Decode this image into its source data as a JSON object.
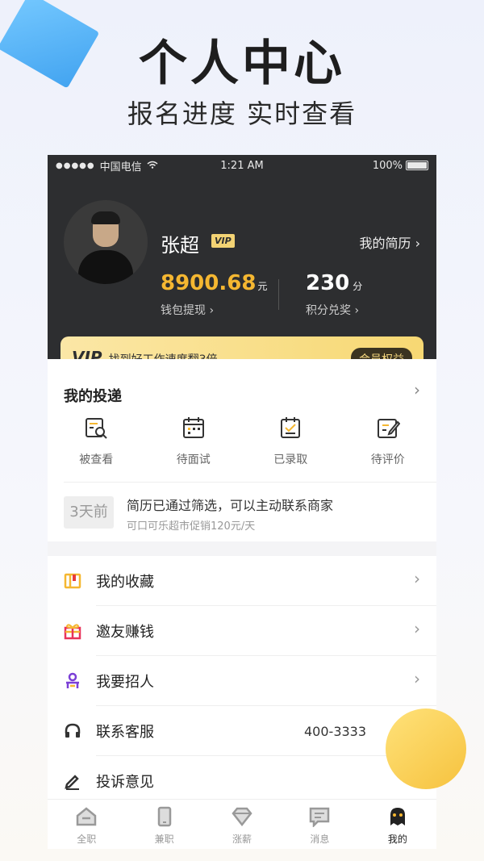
{
  "hero": {
    "title": "个人中心",
    "subtitle": "报名进度  实时查看"
  },
  "status_bar": {
    "signal": "●●●●●",
    "carrier": "中国电信",
    "time": "1:21 AM",
    "battery": "100%"
  },
  "profile": {
    "name": "张超",
    "vip_badge": "VIP",
    "resume_link": "我的简历 ›",
    "wallet_value": "8900.68",
    "wallet_unit": "元",
    "wallet_link": "钱包提现 ›",
    "points_value": "230",
    "points_unit": "分",
    "points_link": "积分兑奖 ›"
  },
  "vip_bar": {
    "label": "VIP",
    "text": "找到好工作速度翻3倍",
    "button": "会员权益"
  },
  "delivery": {
    "title": "我的投递",
    "stats": [
      {
        "label": "被查看",
        "icon": "viewed-icon"
      },
      {
        "label": "待面试",
        "icon": "calendar-icon"
      },
      {
        "label": "已录取",
        "icon": "accepted-icon"
      },
      {
        "label": "待评价",
        "icon": "review-icon"
      }
    ],
    "notice": {
      "days": "3天前",
      "message": "简历已通过筛选，可以主动联系商家",
      "sub": "可口可乐超市促销120元/天"
    }
  },
  "menu": [
    {
      "label": "我的收藏",
      "icon": "favorites-icon",
      "value": ""
    },
    {
      "label": "邀友赚钱",
      "icon": "gift-icon",
      "value": ""
    },
    {
      "label": "我要招人",
      "icon": "recruit-icon",
      "value": ""
    },
    {
      "label": "联系客服",
      "icon": "headset-icon",
      "value": "400-3333"
    },
    {
      "label": "投诉意见",
      "icon": "edit-icon",
      "value": ""
    }
  ],
  "tabs": [
    {
      "label": "全职",
      "icon": "fulltime-icon"
    },
    {
      "label": "兼职",
      "icon": "parttime-icon"
    },
    {
      "label": "涨薪",
      "icon": "diamond-icon"
    },
    {
      "label": "消息",
      "icon": "message-icon"
    },
    {
      "label": "我的",
      "icon": "me-icon"
    }
  ],
  "colors": {
    "accent": "#f5b731",
    "dark": "#2d2e30",
    "vip_gold": "#f7d873"
  }
}
